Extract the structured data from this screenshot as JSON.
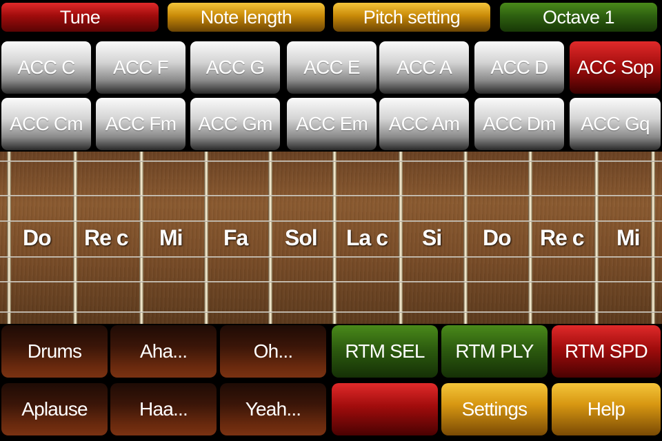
{
  "top_bar": [
    "Tune",
    "Note length",
    "Pitch setting",
    "Octave 1"
  ],
  "acc_row1": [
    "ACC C",
    "ACC F",
    "ACC G",
    "ACC E",
    "ACC A",
    "ACC D",
    "ACC Sop"
  ],
  "acc_row2": [
    "ACC Cm",
    "ACC Fm",
    "ACC Gm",
    "ACC Em",
    "ACC Am",
    "ACC Dm",
    "ACC Gq"
  ],
  "notes": [
    "Do",
    "Re c",
    "Mi",
    "Fa",
    "Sol",
    "La c",
    "Si",
    "Do",
    "Re c",
    "Mi"
  ],
  "bottom_row1": [
    "Drums",
    "Aha...",
    "Oh...",
    "RTM SEL",
    "RTM PLY",
    "RTM SPD"
  ],
  "bottom_row2": [
    "Aplause",
    "Haa...",
    "Yeah...",
    "",
    "Settings",
    "Help"
  ],
  "colors": {
    "red": "#a00c0c",
    "gold": "#d89812",
    "green": "#2e6010",
    "gray": "#d4d4d4",
    "wood": "#7a4d28"
  }
}
